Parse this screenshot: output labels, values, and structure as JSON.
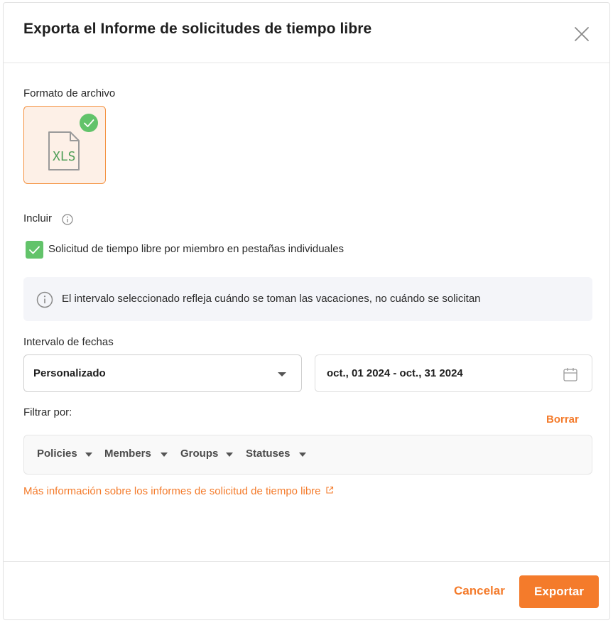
{
  "dialog": {
    "title": "Exporta el Informe de solicitudes de tiempo libre"
  },
  "file_format": {
    "label": "Formato de archivo",
    "selected": "XLS",
    "icon": "xls-file-icon"
  },
  "include": {
    "label": "Incluir",
    "checkbox_label": "Solicitud de tiempo libre por miembro en pestañas individuales",
    "checked": true
  },
  "notice": {
    "text": "El intervalo seleccionado refleja cuándo se toman las vacaciones, no cuándo se solicitan"
  },
  "date_range": {
    "label": "Intervalo de fechas",
    "preset": "Personalizado",
    "range_text": "oct., 01 2024 - oct., 31 2024"
  },
  "filters": {
    "label": "Filtrar por:",
    "clear_label": "Borrar",
    "items": [
      "Policies",
      "Members",
      "Groups",
      "Statuses"
    ]
  },
  "more_info": {
    "text": "Más información sobre los informes de solicitud de tiempo libre"
  },
  "footer": {
    "cancel_label": "Cancelar",
    "export_label": "Exportar"
  },
  "colors": {
    "accent": "#f47b2b",
    "success": "#62c36a",
    "notice_bg": "#f4f5f9"
  }
}
